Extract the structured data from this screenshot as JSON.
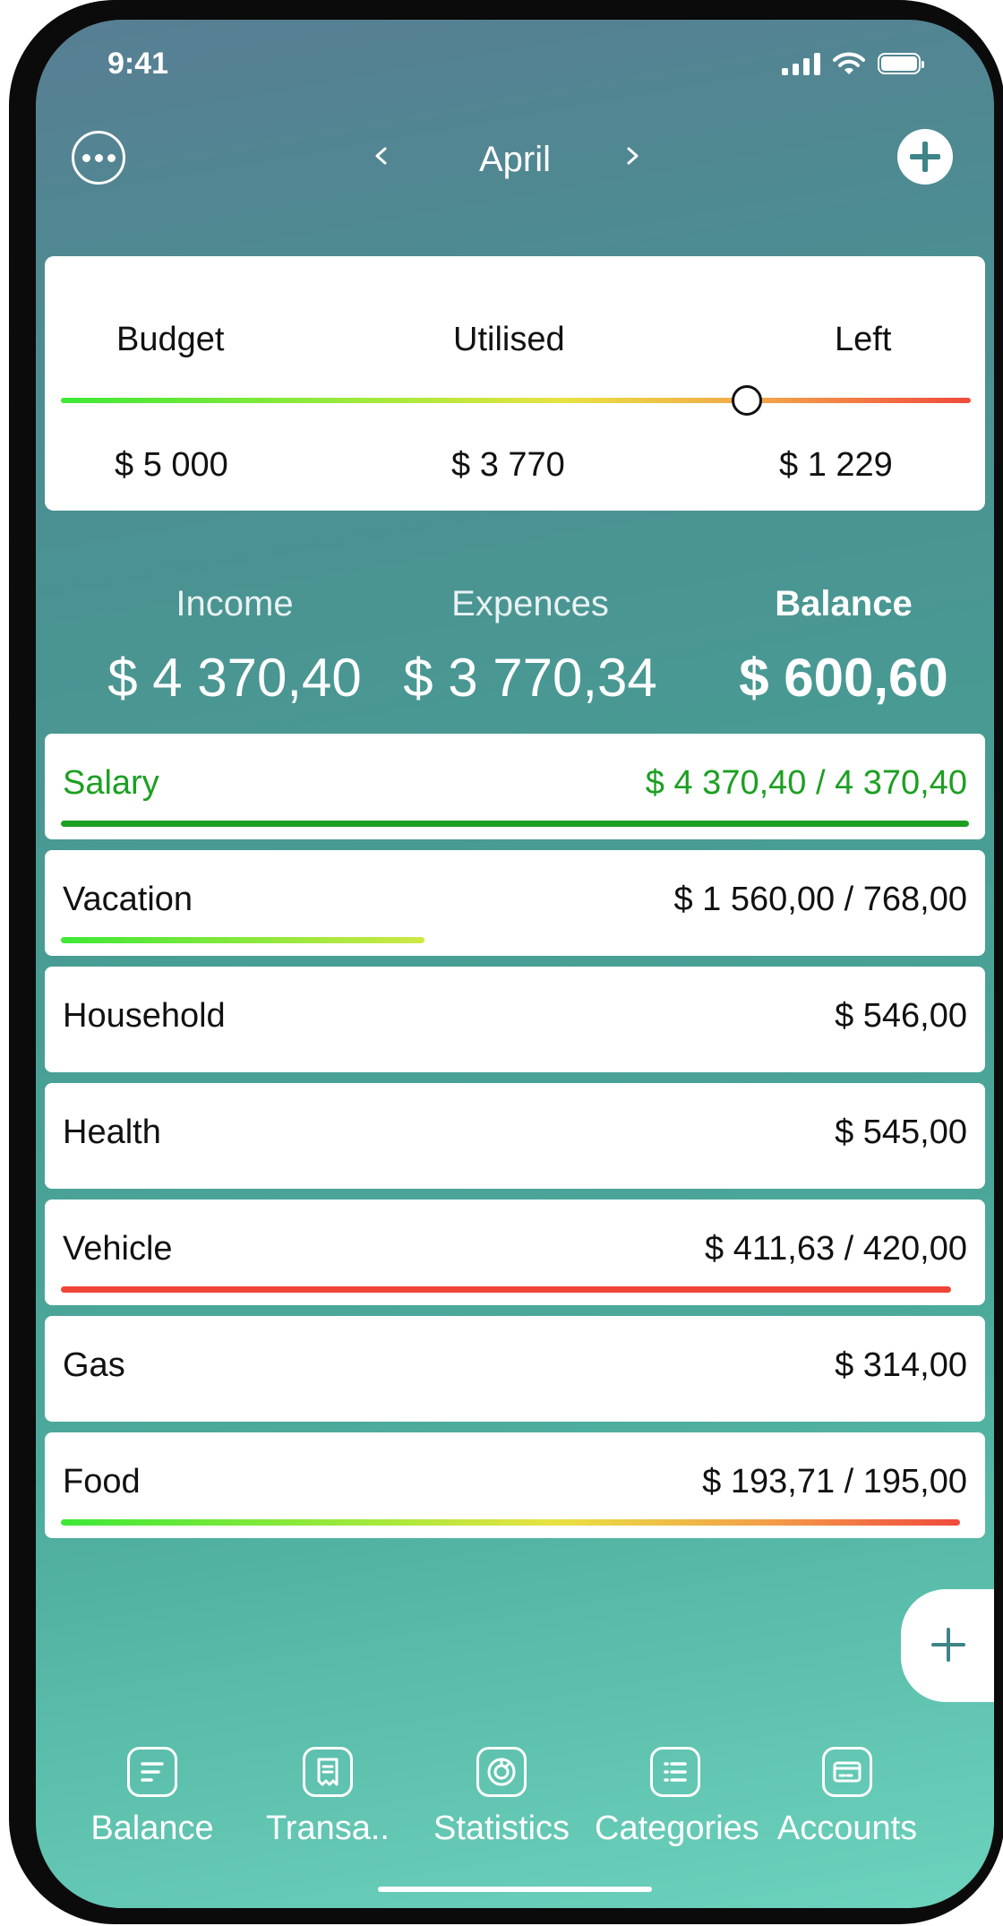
{
  "status_bar": {
    "time": "9:41"
  },
  "header": {
    "month": "April"
  },
  "budget": {
    "labels": {
      "budget": "Budget",
      "utilised": "Utilised",
      "left": "Left"
    },
    "values": {
      "budget": "$ 5 000",
      "utilised": "$ 3 770",
      "left": "$ 1 229"
    },
    "utilised_fraction": 0.754
  },
  "summary": {
    "income_label": "Income",
    "income_value": "$ 4 370,40",
    "expenses_label": "Expences",
    "expenses_value": "$ 3 770,34",
    "balance_label": "Balance",
    "balance_value": "$ 600,60"
  },
  "categories": [
    {
      "name": "Salary",
      "amount": "$ 4 370,40 / 4 370,40",
      "progress": 1.0,
      "color": "#1d9f22",
      "bar": "#1d9f22"
    },
    {
      "name": "Vacation",
      "amount": "$ 1 560,00 / 768,00",
      "progress": 0.4,
      "color": "#111111",
      "bar": "gradient-green"
    },
    {
      "name": "Household",
      "amount": "$ 546,00",
      "progress": null,
      "color": "#111111"
    },
    {
      "name": "Health",
      "amount": "$ 545,00",
      "progress": null,
      "color": "#111111"
    },
    {
      "name": "Vehicle",
      "amount": "$ 411,63 / 420,00",
      "progress": 0.98,
      "color": "#111111",
      "bar": "#f04437"
    },
    {
      "name": "Gas",
      "amount": "$ 314,00",
      "progress": null,
      "color": "#111111"
    },
    {
      "name": "Food",
      "amount": "$ 193,71 / 195,00",
      "progress": 0.99,
      "color": "#111111",
      "bar": "gradient-full"
    }
  ],
  "tabs": [
    {
      "label": "Balance",
      "icon": "balance-icon"
    },
    {
      "label": "Transa..",
      "icon": "receipt-icon"
    },
    {
      "label": "Statistics",
      "icon": "statistics-icon"
    },
    {
      "label": "Categories",
      "icon": "list-icon"
    },
    {
      "label": "Accounts",
      "icon": "card-icon"
    }
  ],
  "colors": {
    "accent": "#3f8486",
    "income": "#1d9f22",
    "over_budget": "#f04437"
  }
}
